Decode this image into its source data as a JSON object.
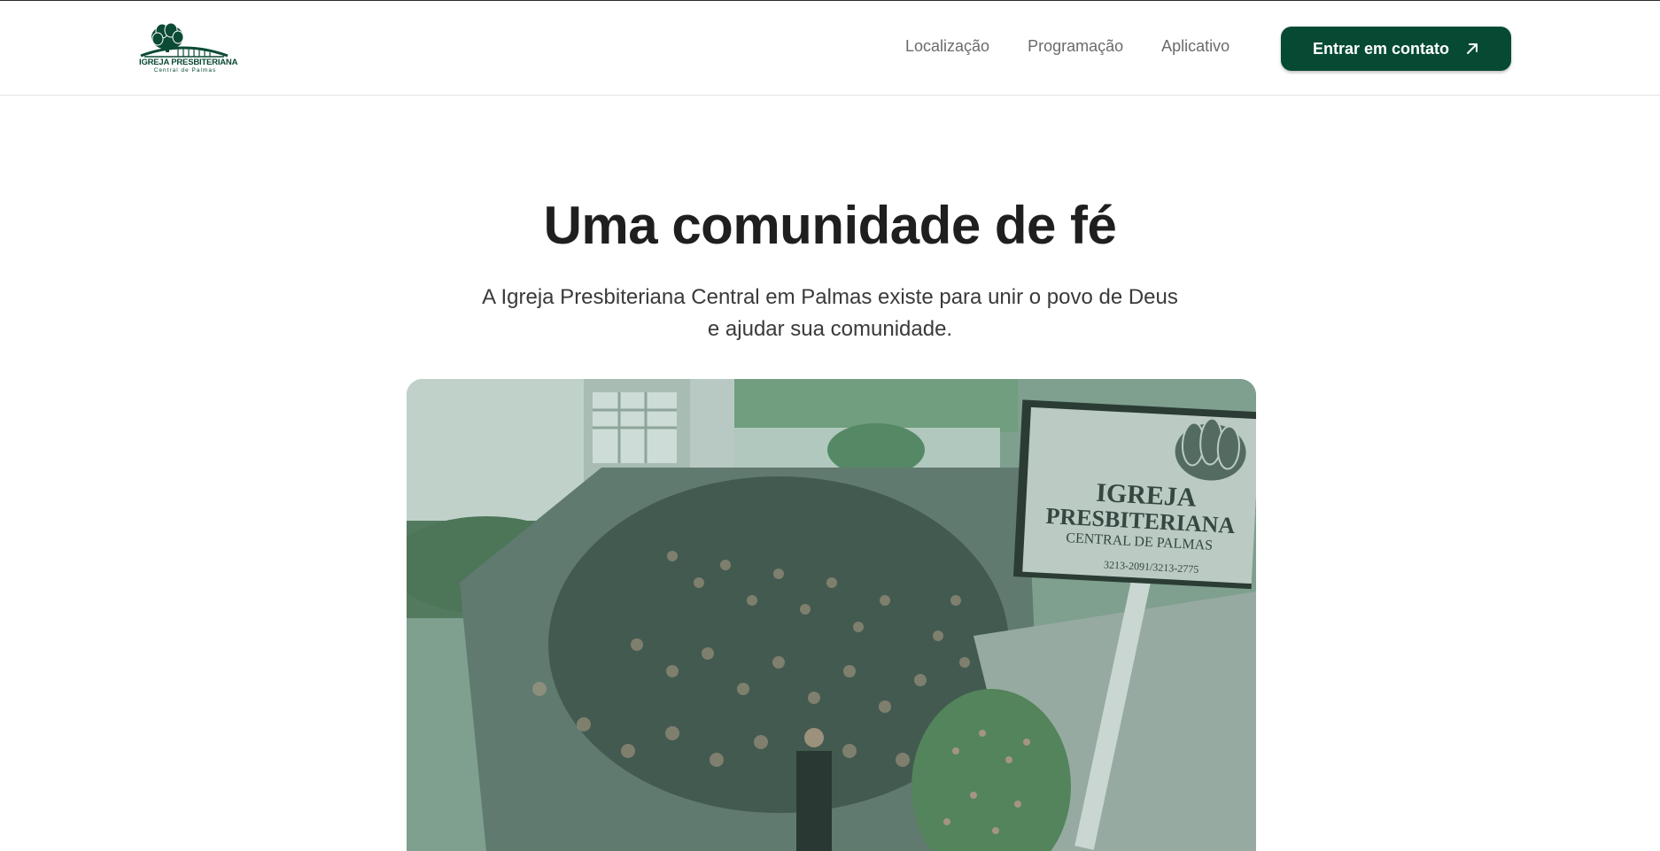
{
  "header": {
    "logo": {
      "icon": "tree-bridge-logo",
      "line1": "IGREJA PRESBITERIANA",
      "line2": "Central de Palmas"
    },
    "nav": [
      {
        "label": "Localização"
      },
      {
        "label": "Programação"
      },
      {
        "label": "Aplicativo"
      }
    ],
    "cta": {
      "label": "Entrar em contato",
      "icon": "arrow-up-right-icon"
    }
  },
  "hero": {
    "title": "Uma comunidade de fé",
    "subtitle": "A Igreja Presbiteriana Central em Palmas existe para unir o povo de Deus e ajudar sua comunidade.",
    "photo": {
      "sign": {
        "line1": "IGREJA",
        "line2": "PRESBITERIANA",
        "line3": "CENTRAL DE PALMAS",
        "phone": "3213-2091/3213-2775"
      }
    }
  },
  "colors": {
    "brand": "#064a33",
    "nav_text": "#6b6b6b",
    "title": "#1f1f1f"
  }
}
